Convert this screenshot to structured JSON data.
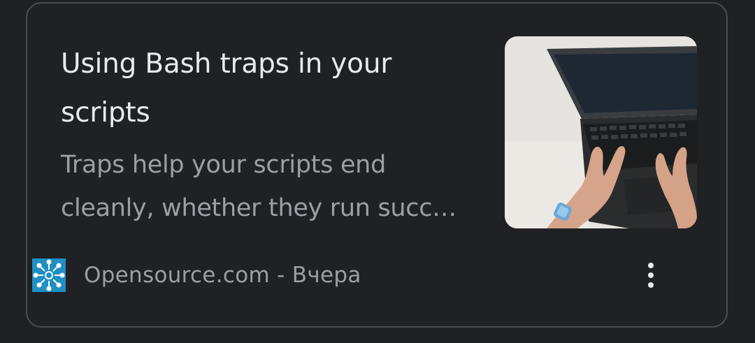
{
  "article": {
    "title": "Using Bash traps in your scripts",
    "snippet": "Traps help your scripts end cleanly, whether they run succ…",
    "source": "Opensource.com - Вчера",
    "favicon": "opensource-logo-icon",
    "thumbnail": "laptop-typing-image",
    "menu_icon": "more-vert-icon"
  },
  "colors": {
    "background": "#202124",
    "border": "#4a4c50",
    "title": "#e8eaed",
    "secondary_text": "#9aa0a6",
    "favicon_bg": "#1f8fc4"
  }
}
